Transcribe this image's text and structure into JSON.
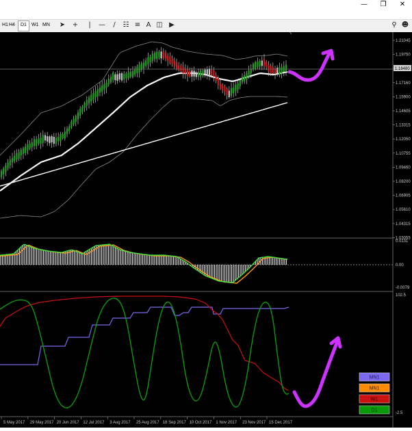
{
  "window": {
    "minimize_icon": "minimize-icon",
    "restore_icon": "restore-icon",
    "close_icon": "close-icon"
  },
  "toolbar": {
    "timeframes": [
      "H1",
      "H4",
      "D1",
      "W1",
      "MN"
    ],
    "active_timeframe": "D1",
    "tools": [
      "cursor-icon",
      "crosshair-icon",
      "vertical-line-icon",
      "horizontal-line-icon",
      "trendline-icon",
      "channel-icon",
      "fibonacci-icon",
      "text-icon",
      "label-icon",
      "shapes-dropdown-icon"
    ],
    "right_tools": [
      "search-icon",
      "account-icon"
    ]
  },
  "main_axis": {
    "ticks": [
      "1.21045",
      "1.19750",
      "1.18480",
      "1.17160",
      "1.15900",
      "1.14605",
      "1.13315",
      "1.12050",
      "1.10755",
      "1.09460",
      "1.08200",
      "1.06905",
      "1.05610",
      "1.04315",
      "1.03055"
    ],
    "current_price": "1.18480"
  },
  "macd_axis": {
    "ticks": [
      "0.0131",
      "0.00",
      "-0.0079"
    ]
  },
  "strength_axis": {
    "ticks": [
      "102.5",
      "-2.5"
    ]
  },
  "date_axis": {
    "ticks": [
      "5 May 2017",
      "29 May 2017",
      "20 Jun 2017",
      "12 Jul 2017",
      "3 Aug 2017",
      "25 Aug 2017",
      "18 Sep 2017",
      "10 Oct 2017",
      "1 Nov 2017",
      "23 Nov 2017",
      "15 Dec 2017"
    ]
  },
  "legend": [
    {
      "label": "MN1",
      "color": "#7b68ee",
      "text_color": "#1a1a60"
    },
    {
      "label": "MN1",
      "color": "#ff8c00",
      "text_color": "#3a2000"
    },
    {
      "label": "W1",
      "color": "#cc1111",
      "text_color": "#2a0000"
    },
    {
      "label": "D1",
      "color": "#0a9a0a",
      "text_color": "#003000"
    }
  ],
  "colors": {
    "background": "#000000",
    "bull_candle": "#1fa01f",
    "bear_candle": "#d11b1b",
    "neutral_candle": "#c8c8c8",
    "band": "#8a8a8a",
    "ma": "#ffffff",
    "annotation": "#cc33ff",
    "macd_orange": "#ff9a1a",
    "macd_green": "#3ee03e"
  }
}
